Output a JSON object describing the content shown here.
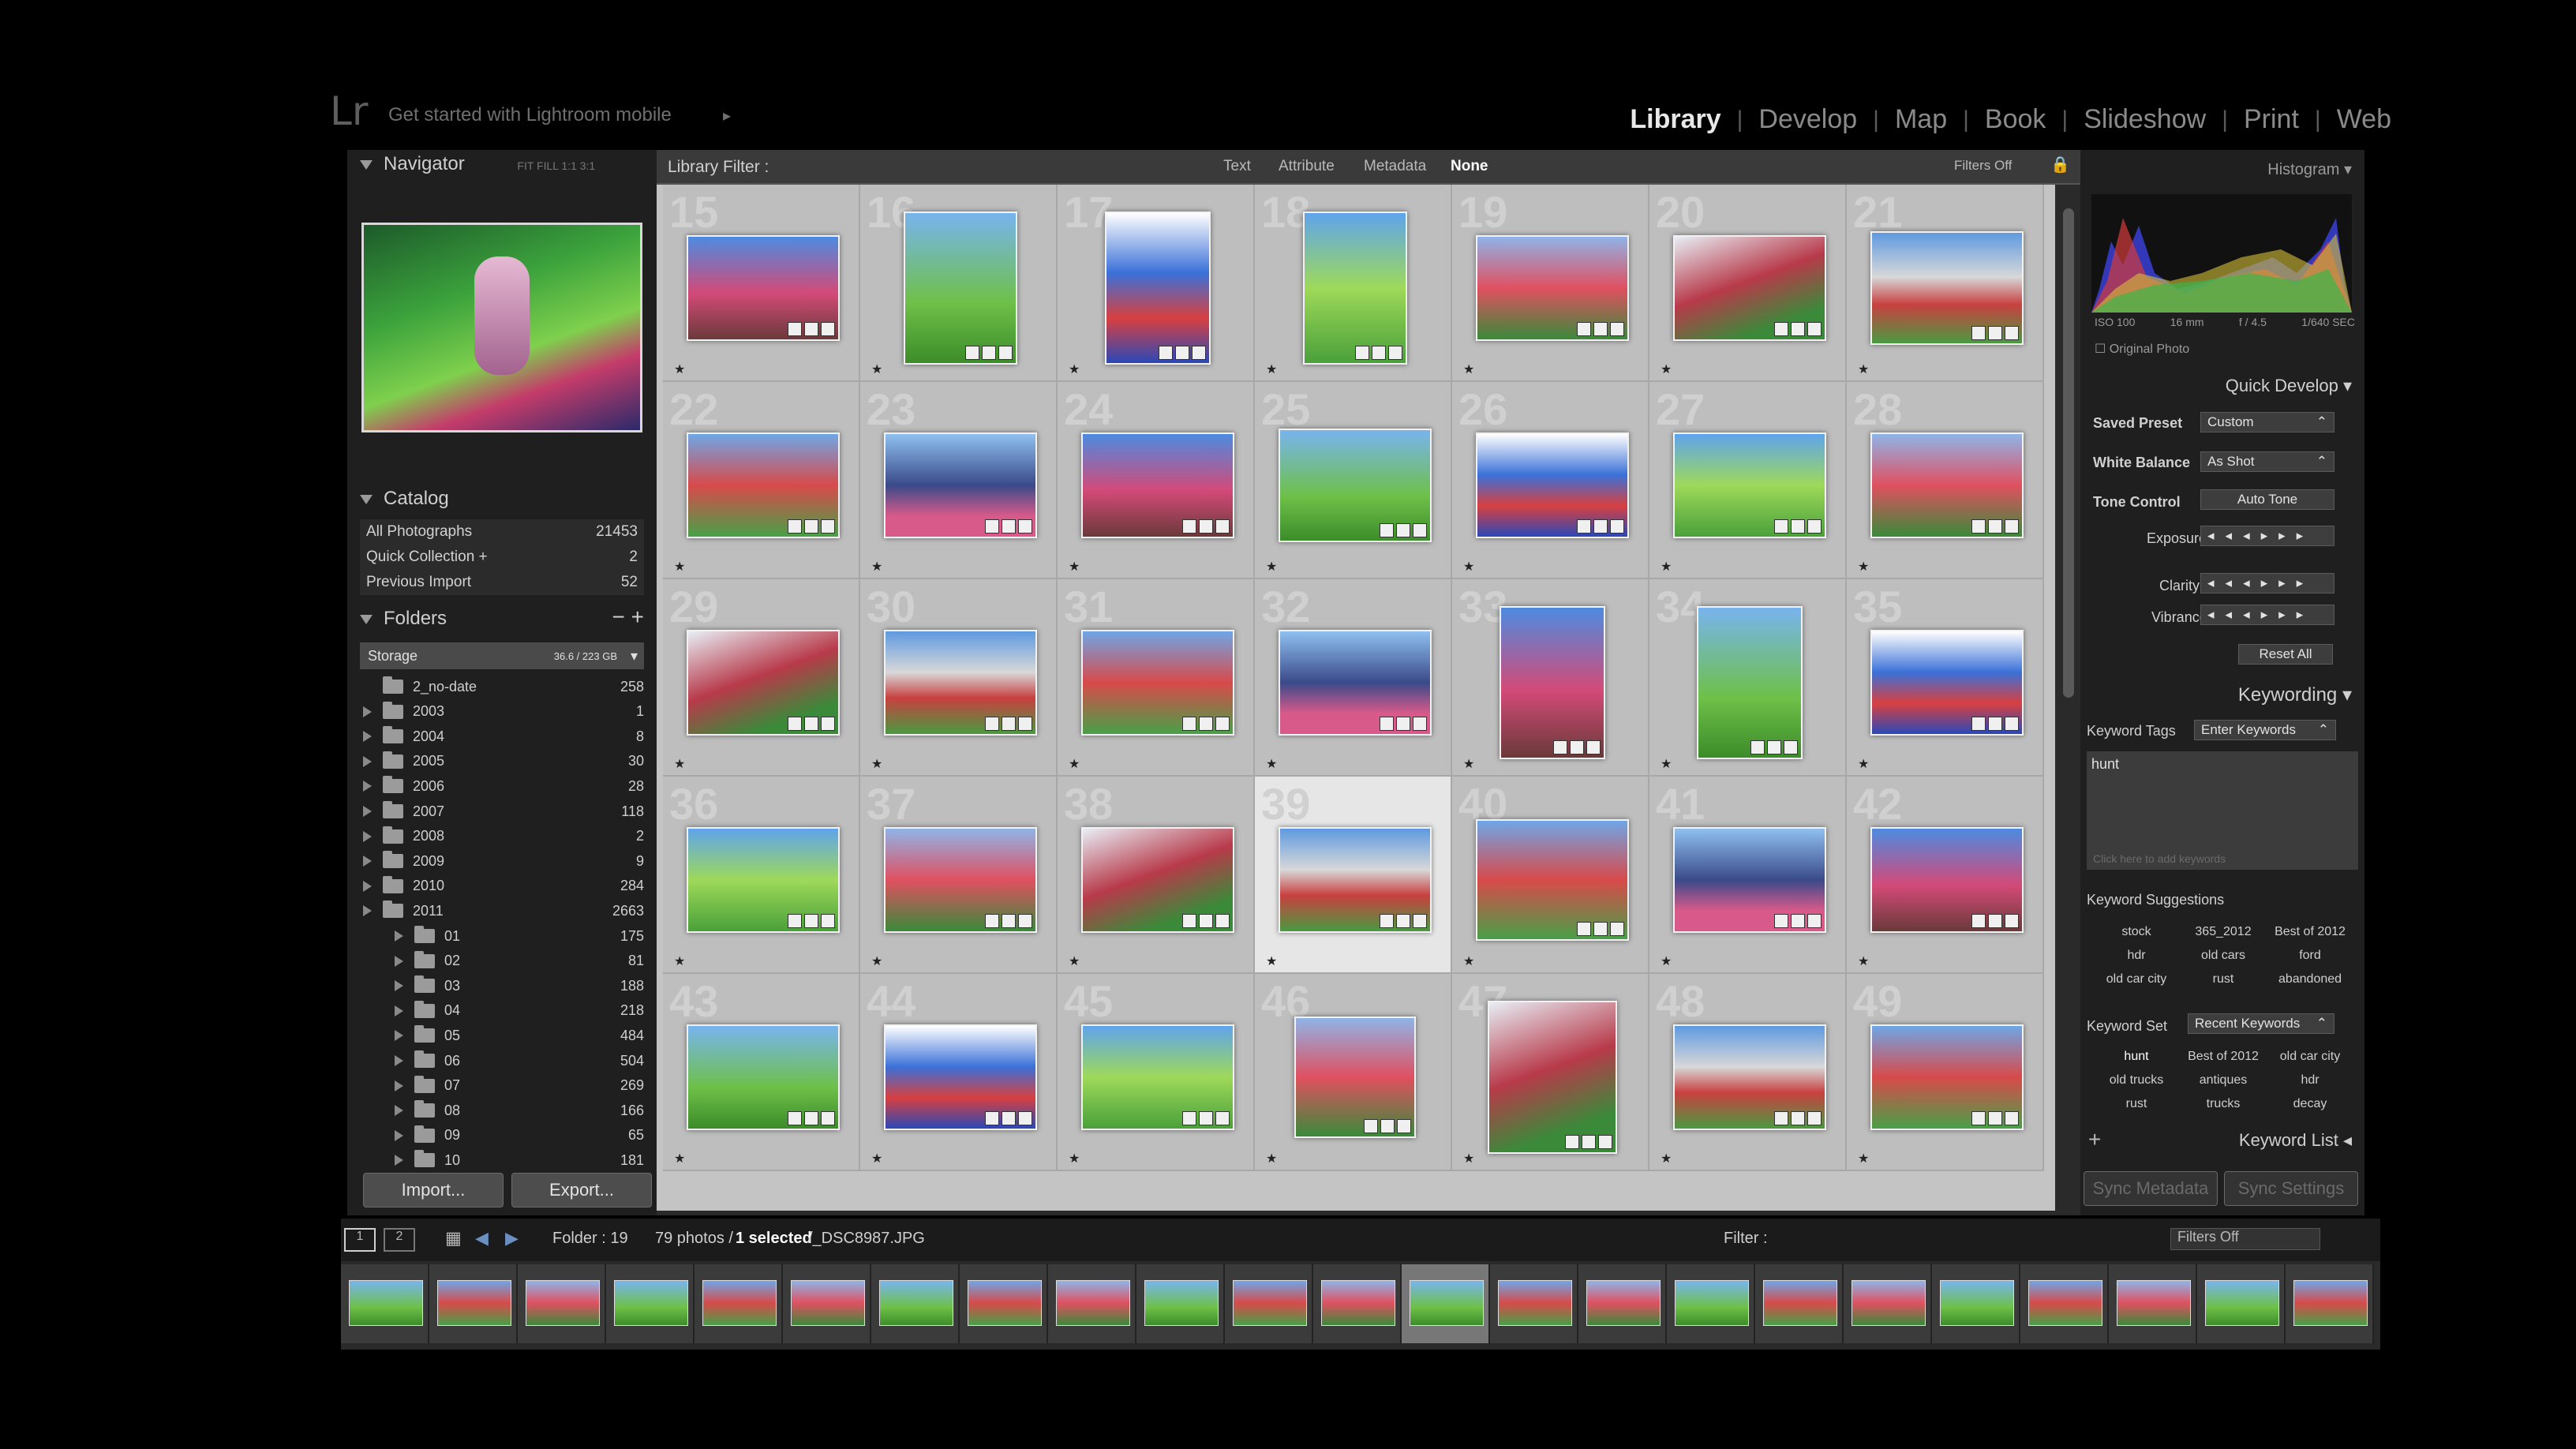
{
  "app": {
    "logo": "Lr",
    "mobile_prompt": "Get started with Lightroom mobile",
    "modules": [
      "Library",
      "Develop",
      "Map",
      "Book",
      "Slideshow",
      "Print",
      "Web"
    ],
    "active_module": "Library"
  },
  "navigator": {
    "title": "Navigator",
    "zoom_options": "FIT FILL 1:1 3:1"
  },
  "catalog": {
    "title": "Catalog",
    "items": [
      {
        "label": "All Photographs",
        "count": "21453"
      },
      {
        "label": "Quick Collection +",
        "count": "2"
      },
      {
        "label": "Previous Import",
        "count": "52"
      }
    ]
  },
  "folders": {
    "title": "Folders",
    "storage_label": "Storage",
    "storage_size": "36.6 / 223 GB",
    "items": [
      {
        "label": "2_no-date",
        "count": "258"
      },
      {
        "label": "2003",
        "count": "1"
      },
      {
        "label": "2004",
        "count": "8"
      },
      {
        "label": "2005",
        "count": "30"
      },
      {
        "label": "2006",
        "count": "28"
      },
      {
        "label": "2007",
        "count": "118"
      },
      {
        "label": "2008",
        "count": "2"
      },
      {
        "label": "2009",
        "count": "9"
      },
      {
        "label": "2010",
        "count": "284"
      },
      {
        "label": "2011",
        "count": "2663"
      },
      {
        "label": "01",
        "count": "175"
      },
      {
        "label": "02",
        "count": "81"
      },
      {
        "label": "03",
        "count": "188"
      },
      {
        "label": "04",
        "count": "218"
      },
      {
        "label": "05",
        "count": "484"
      },
      {
        "label": "06",
        "count": "504"
      },
      {
        "label": "07",
        "count": "269"
      },
      {
        "label": "08",
        "count": "166"
      },
      {
        "label": "09",
        "count": "65"
      },
      {
        "label": "10",
        "count": "181"
      }
    ],
    "import_label": "Import...",
    "export_label": "Export..."
  },
  "library_filter": {
    "label": "Library Filter :",
    "options": [
      "Text",
      "Attribute",
      "Metadata",
      "None"
    ],
    "active": "None",
    "filters_off": "Filters Off"
  },
  "grid": {
    "cell_numbers": [
      "15",
      "16",
      "17",
      "18",
      "19",
      "20",
      "21",
      "22",
      "23",
      "24",
      "25",
      "26",
      "27",
      "28",
      "29",
      "30",
      "31",
      "32",
      "33",
      "34",
      "35",
      "36",
      "37",
      "38",
      "39",
      "40",
      "41",
      "42",
      "43",
      "44",
      "45",
      "46",
      "47",
      "48",
      "49"
    ],
    "selected_index": 24
  },
  "histogram": {
    "title": "Histogram",
    "iso": "ISO 100",
    "focal": "16 mm",
    "aperture": "f / 4.5",
    "shutter": "1/640 SEC",
    "original_photo": "Original Photo"
  },
  "quick_develop": {
    "title": "Quick Develop",
    "saved_preset_label": "Saved Preset",
    "saved_preset_value": "Custom",
    "white_balance_label": "White Balance",
    "white_balance_value": "As Shot",
    "tone_control_label": "Tone Control",
    "auto_tone": "Auto Tone",
    "exposure": "Exposure",
    "clarity": "Clarity",
    "vibrance": "Vibrance",
    "reset_all": "Reset All"
  },
  "keywording": {
    "title": "Keywording",
    "keyword_tags_label": "Keyword Tags",
    "keyword_tags_value": "Enter Keywords",
    "keyword_text": "hunt",
    "add_placeholder": "Click here to add keywords",
    "suggestions_title": "Keyword Suggestions",
    "suggestions": [
      "stock",
      "365_2012",
      "Best of 2012",
      "hdr",
      "old cars",
      "ford",
      "old car city",
      "rust",
      "abandoned"
    ],
    "keyword_set_label": "Keyword Set",
    "keyword_set_value": "Recent Keywords",
    "keyword_set": [
      "hunt",
      "Best of 2012",
      "old car city",
      "old trucks",
      "antiques",
      "hdr",
      "rust",
      "trucks",
      "decay"
    ],
    "keyword_list": "Keyword List",
    "sync_metadata": "Sync Metadata",
    "sync_settings": "Sync Settings"
  },
  "toolbar": {
    "view1": "1",
    "view2": "2",
    "folder": "Folder : 19",
    "photos": "79 photos /",
    "selected": "1 selected",
    "filename": "/_DSC8987.JPG",
    "filter_label": "Filter :",
    "filters_off": "Filters Off"
  },
  "colors": {
    "accent": "#e8e8e8",
    "panel": "#1f1f1f",
    "grid": "#c4c4c4"
  }
}
